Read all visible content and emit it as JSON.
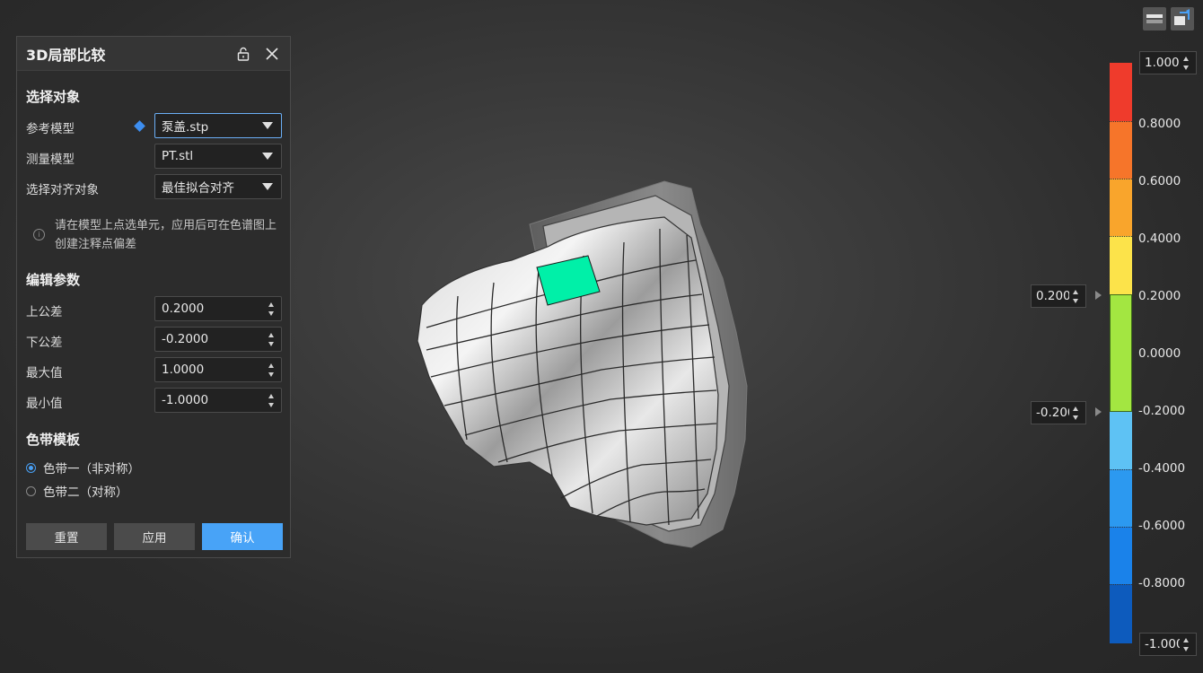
{
  "panel": {
    "title": "3D局部比较",
    "select_section": "选择对象",
    "reference_label": "参考模型",
    "reference_value": "泵盖.stp",
    "measure_label": "测量模型",
    "measure_value": "PT.stl",
    "align_label": "选择对齐对象",
    "align_value": "最佳拟合对齐",
    "info_text": "请在模型上点选单元，应用后可在色谱图上创建注释点偏差",
    "edit_section": "编辑参数",
    "upper_tol_label": "上公差",
    "upper_tol_value": "0.2000",
    "lower_tol_label": "下公差",
    "lower_tol_value": "-0.2000",
    "max_label": "最大值",
    "max_value": "1.0000",
    "min_label": "最小值",
    "min_value": "-1.0000",
    "band_section": "色带模板",
    "band_option1": "色带一（非对称）",
    "band_option2": "色带二（对称）",
    "reset_label": "重置",
    "apply_label": "应用",
    "confirm_label": "确认"
  },
  "colorbar": {
    "max_box": "1.0000",
    "min_box": "-1.0000",
    "upper_box": "0.2000",
    "lower_box": "-0.2000",
    "ticks": [
      "0.8000",
      "0.6000",
      "0.4000",
      "0.2000",
      "0.0000",
      "-0.2000",
      "-0.4000",
      "-0.6000",
      "-0.8000"
    ],
    "colors": {
      "red": "#ef3b2c",
      "orange": "#f6752a",
      "amber": "#f9a52c",
      "yellow": "#fce34a",
      "green": "#a3e641",
      "light_blue": "#5ec2f4",
      "blue": "#1a82ea",
      "dark_blue": "#0d5bbd"
    }
  },
  "model": {
    "highlight_color": "#00f0a8"
  }
}
